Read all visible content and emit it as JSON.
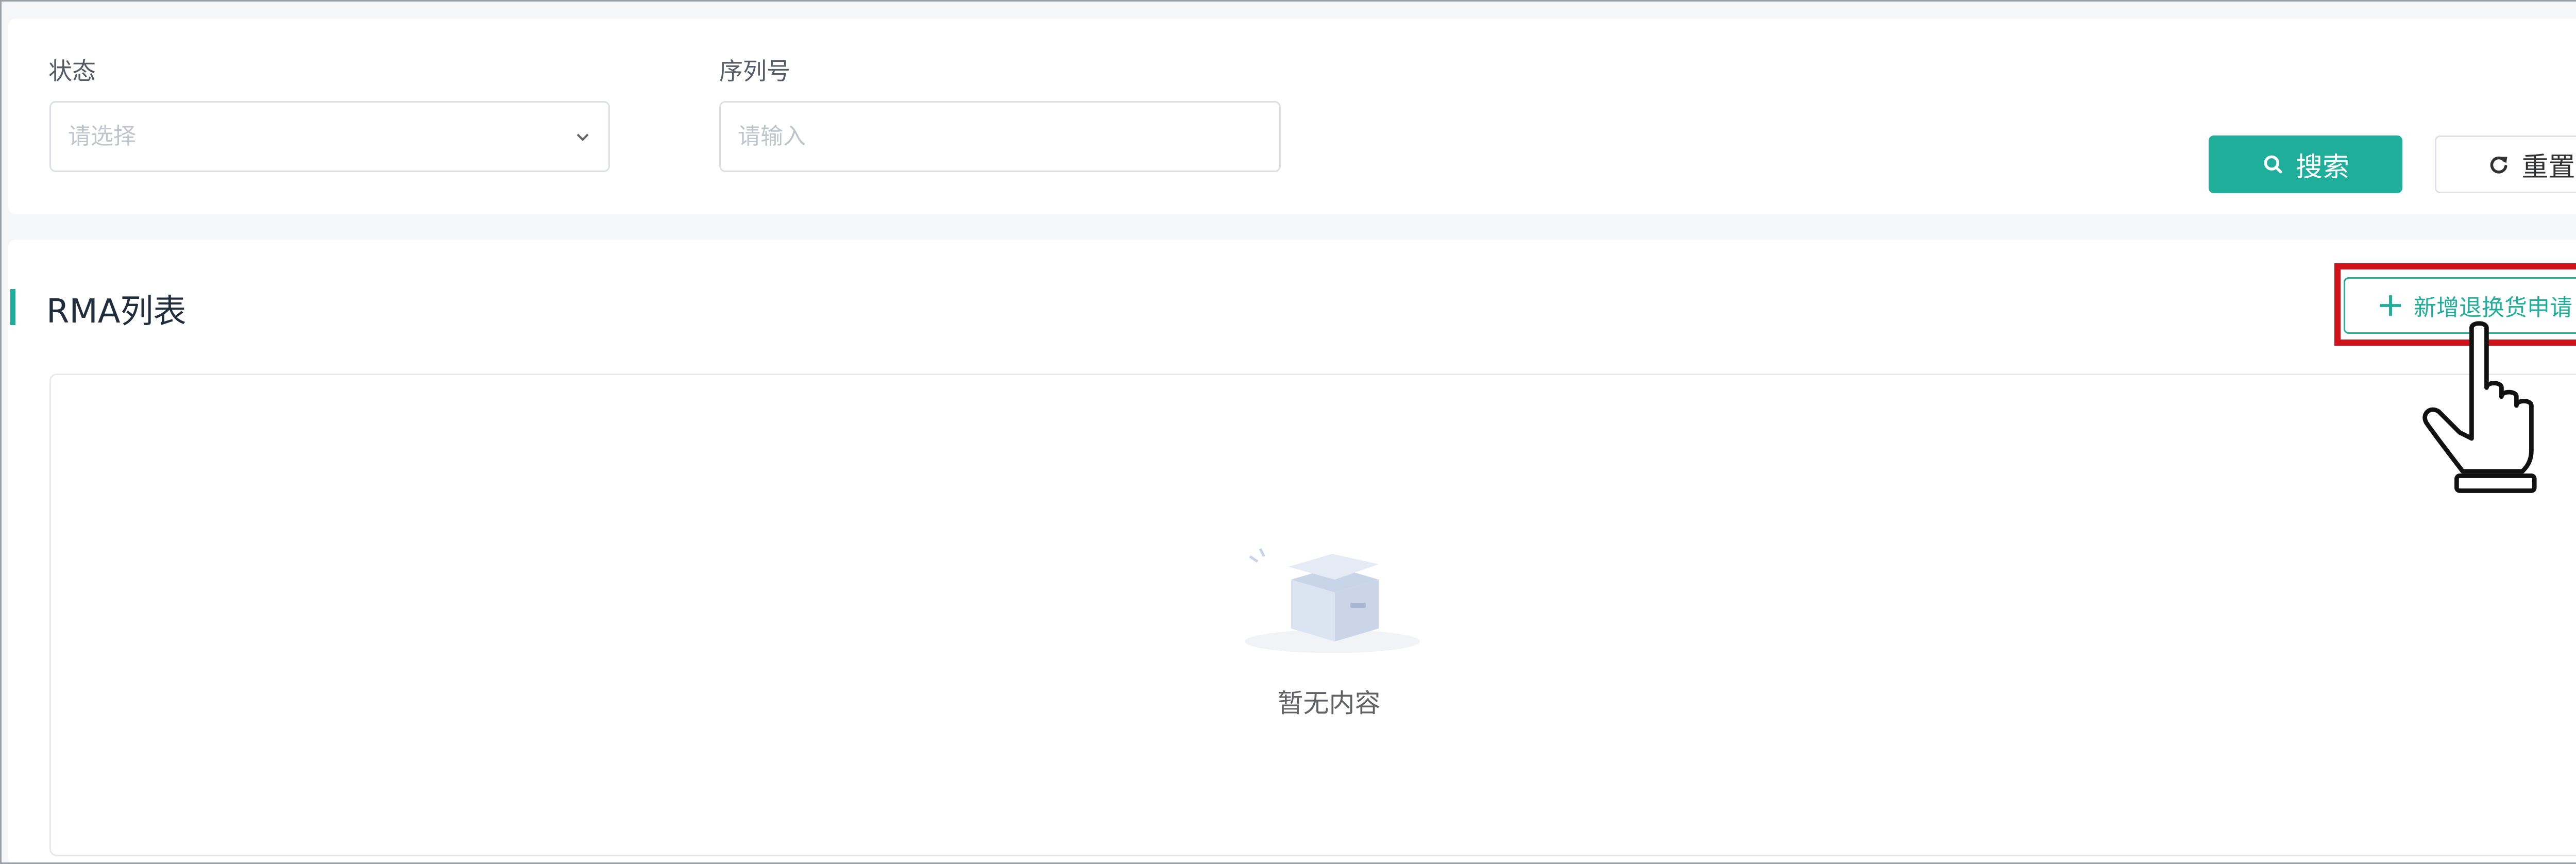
{
  "filters": {
    "status": {
      "label": "状态",
      "placeholder": "请选择"
    },
    "serial": {
      "label": "序列号",
      "placeholder": "请输入"
    },
    "search_label": "搜索",
    "reset_label": "重置"
  },
  "list": {
    "title": "RMA列表",
    "add_label": "新增退换货申请",
    "empty_text": "暂无内容"
  },
  "icons": {
    "search": "search-icon",
    "reset": "refresh-icon",
    "add": "plus-icon",
    "select": "chevron-down-icon",
    "empty": "empty-box-icon",
    "pointer": "hand-pointer-icon"
  },
  "colors": {
    "accent": "#1fae9a",
    "highlight": "#d0121b",
    "placeholder": "#c0c4cc"
  }
}
